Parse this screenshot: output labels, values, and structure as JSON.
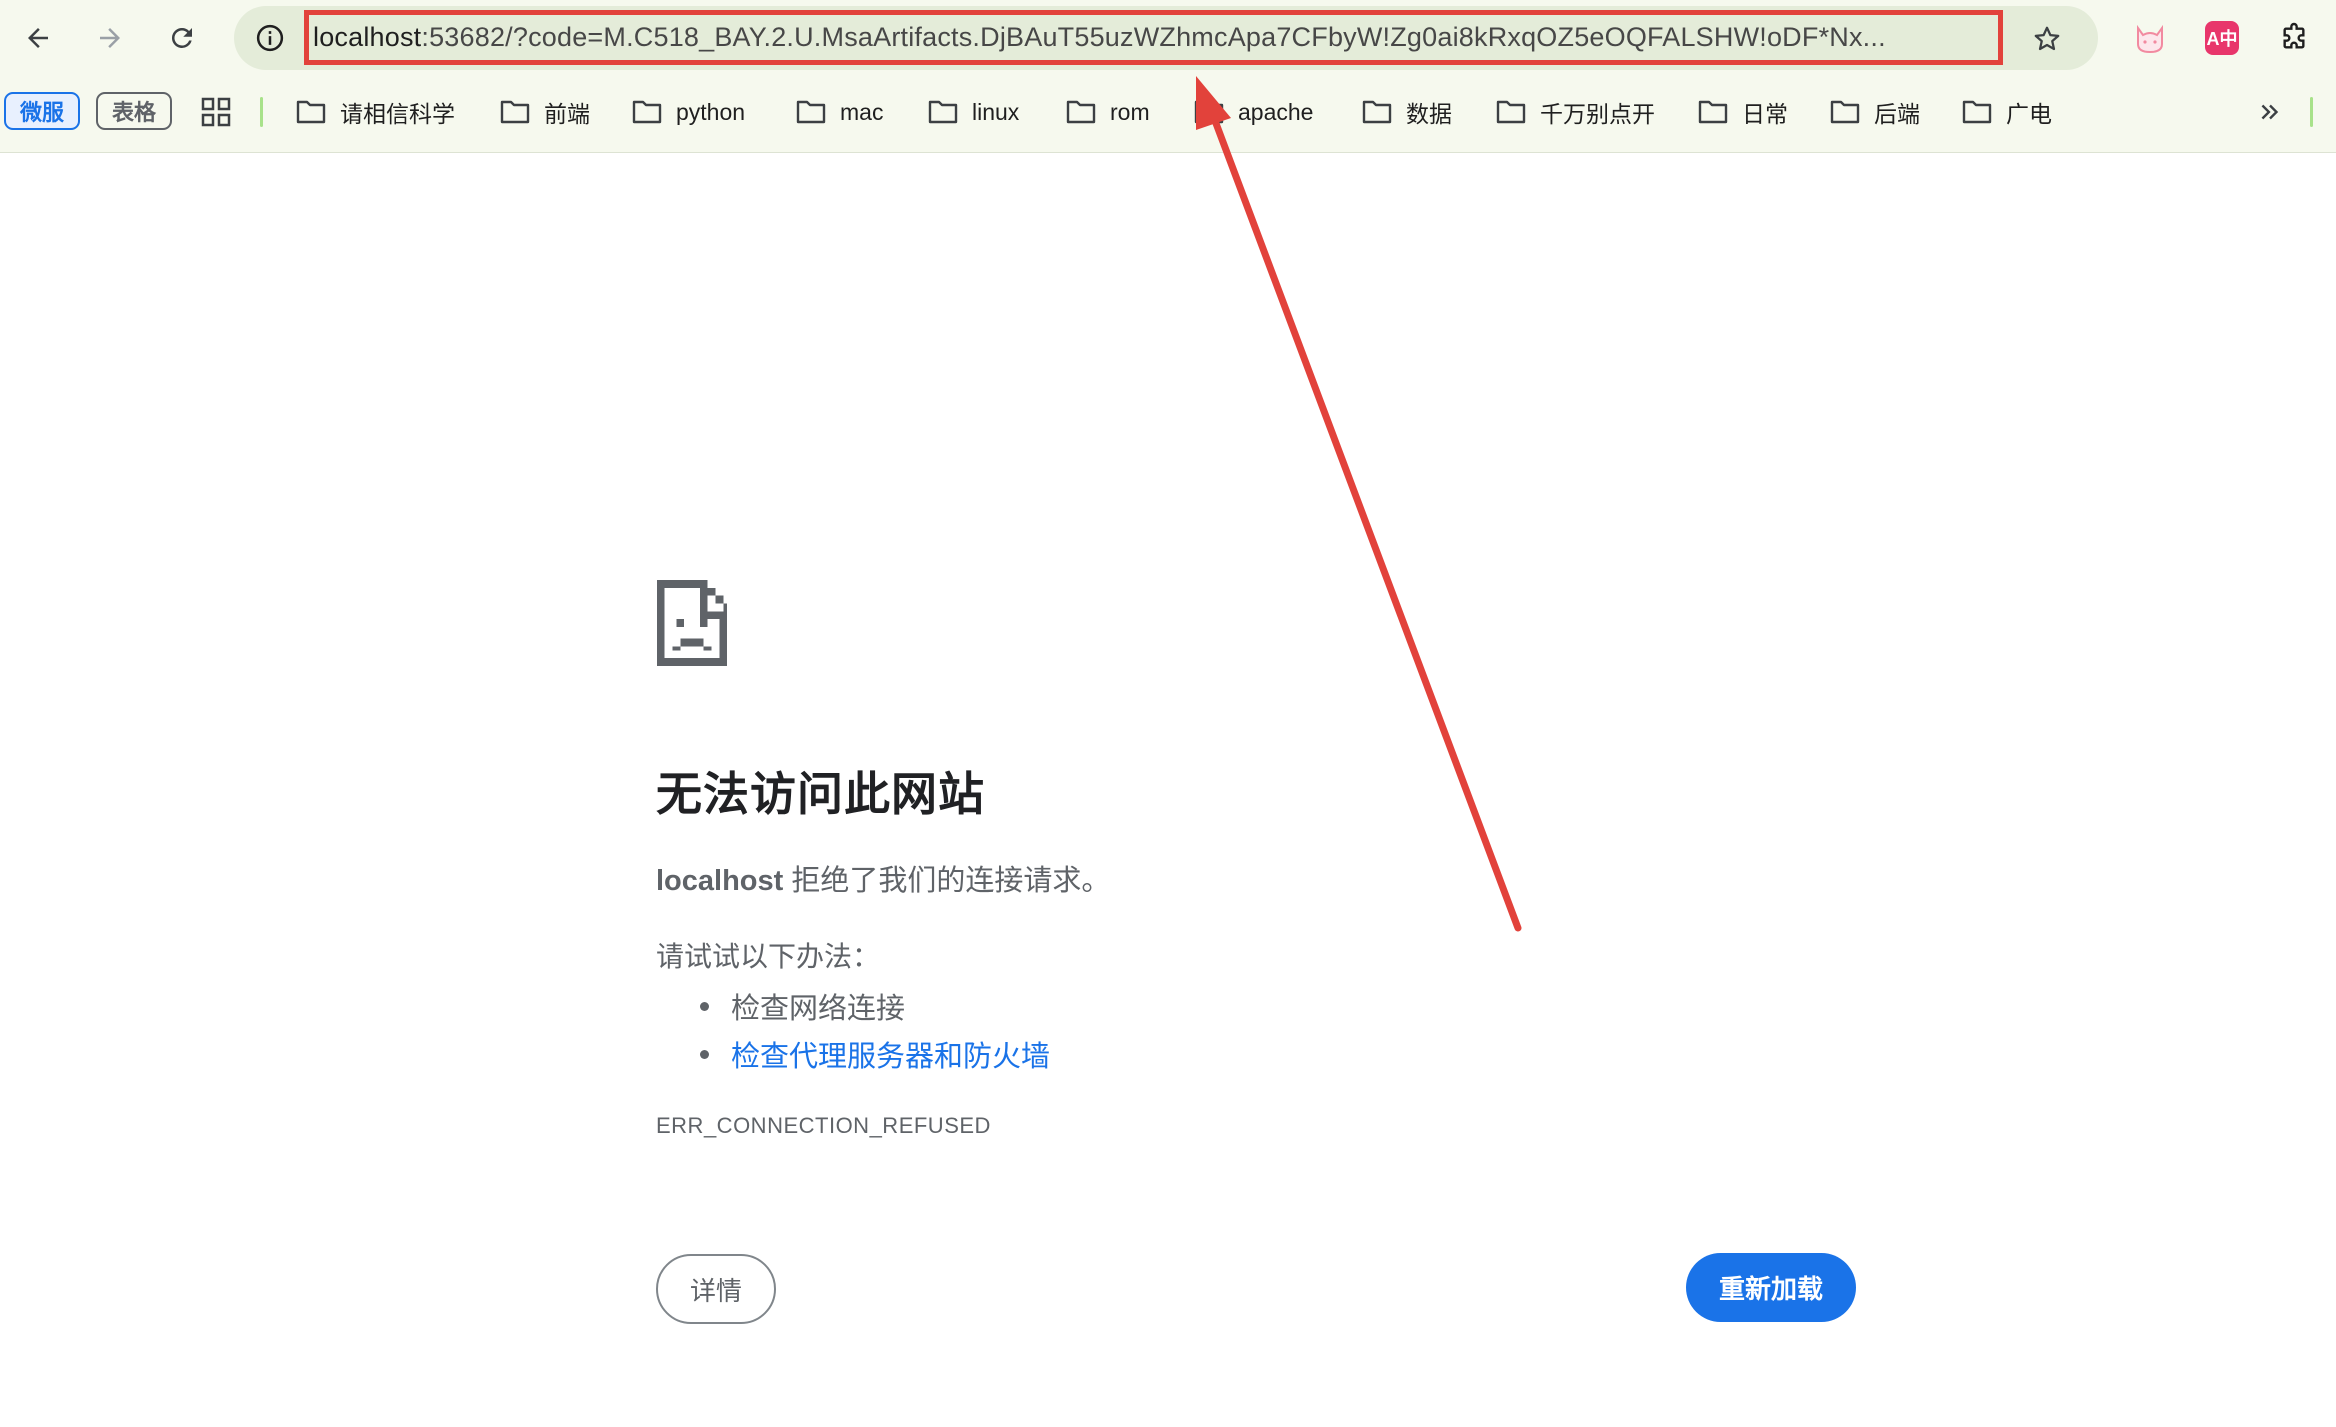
{
  "browser": {
    "url_host": "localhost",
    "url_rest": ":53682/?code=M.C518_BAY.2.U.MsaArtifacts.DjBAuT55uzWZhmcApa7CFbyW!Zg0ai8kRxqOZ5eOQFALSHW!oDF*Nx..."
  },
  "bookmarks": {
    "pills": [
      "微服",
      "表格"
    ],
    "folders": [
      "请相信科学",
      "前端",
      "python",
      "mac",
      "linux",
      "rom",
      "apache",
      "数据",
      "千万别点开",
      "日常",
      "后端",
      "广电"
    ]
  },
  "extensions": {
    "translate_label": "A中"
  },
  "error": {
    "title": "无法访问此网站",
    "host": "localhost",
    "message": " 拒绝了我们的连接请求。",
    "try_label": "请试试以下办法：",
    "suggestions": [
      "检查网络连接",
      "检查代理服务器和防火墙"
    ],
    "code": "ERR_CONNECTION_REFUSED",
    "details_label": "详情",
    "reload_label": "重新加载"
  },
  "colors": {
    "accent": "#1a73e8",
    "annotation": "#e2423b",
    "toolbar_bg": "#f6f9ee"
  }
}
